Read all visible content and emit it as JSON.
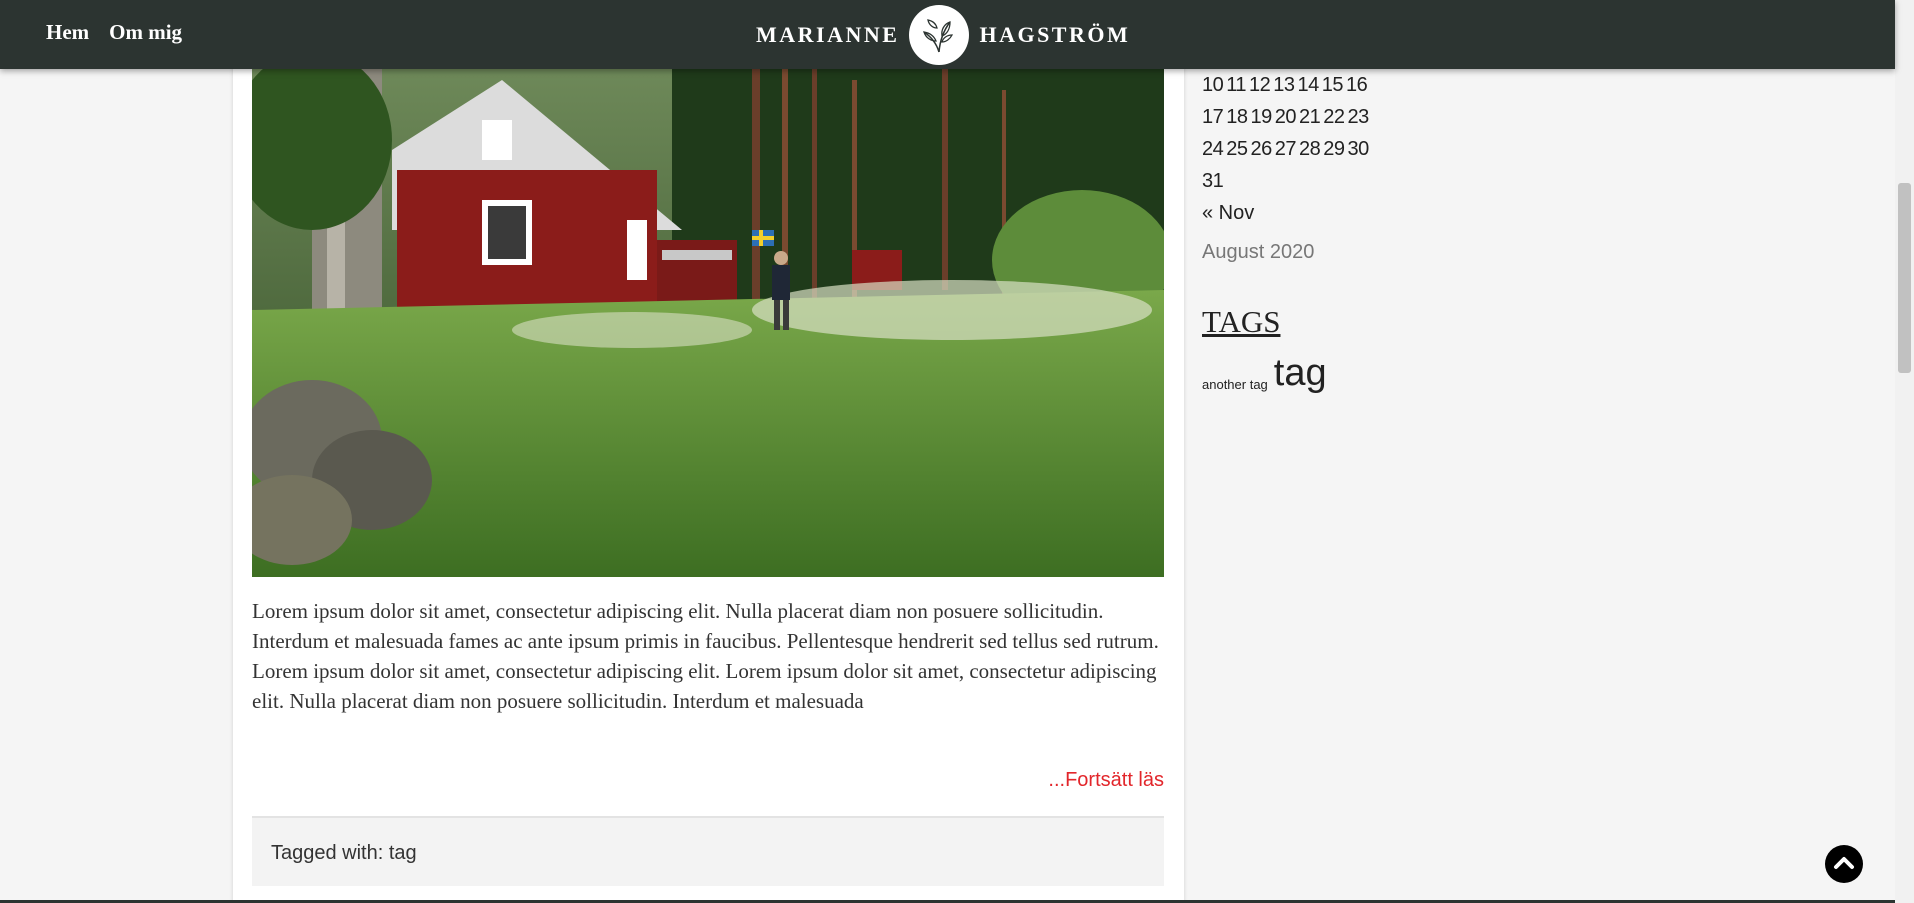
{
  "header": {
    "nav": [
      {
        "label": "Hem"
      },
      {
        "label": "Om mig"
      }
    ],
    "brand_left": "MARIANNE",
    "brand_right": "HAGSTRÖM"
  },
  "post": {
    "excerpt": "Lorem ipsum dolor sit amet, consectetur adipiscing elit. Nulla placerat diam non posuere sollicitudin. Interdum et malesuada fames ac ante ipsum primis in faucibus. Pellentesque hendrerit sed tellus sed rutrum. Lorem ipsum dolor sit amet, consectetur adipiscing elit. Lorem ipsum dolor sit amet, consectetur adipiscing elit. Nulla placerat diam non posuere sollicitudin. Interdum et malesuada",
    "read_more": "...Fortsätt läs",
    "tagged_label": "Tagged with:",
    "tag": "tag"
  },
  "sidebar": {
    "calendar_rows": [
      [
        "10",
        "11",
        "12",
        "13",
        "14",
        "15",
        "16"
      ],
      [
        "17",
        "18",
        "19",
        "20",
        "21",
        "22",
        "23"
      ],
      [
        "24",
        "25",
        "26",
        "27",
        "28",
        "29",
        "30"
      ],
      [
        "31"
      ]
    ],
    "prev_link": "« Nov",
    "caption": "August 2020",
    "tags_heading": "TAGS",
    "tags": [
      {
        "label": "another tag"
      },
      {
        "label": "tag"
      }
    ]
  },
  "icons": {
    "logo": "leaf-logo-icon",
    "back_to_top": "chevron-up-icon"
  }
}
